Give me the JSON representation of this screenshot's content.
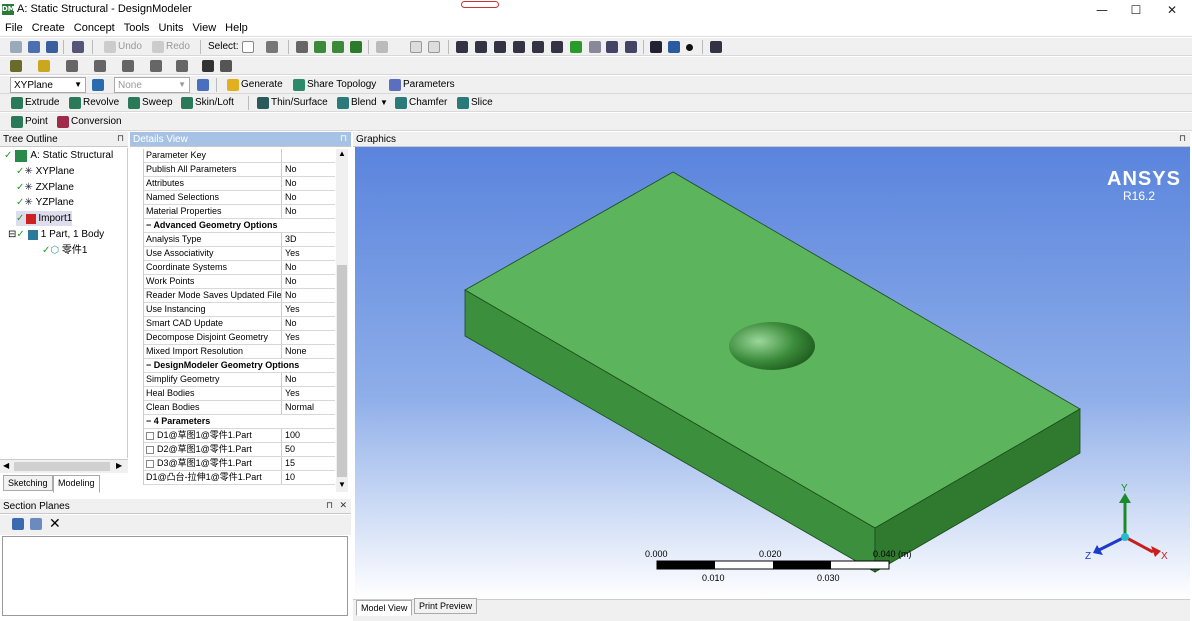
{
  "window": {
    "title": "A: Static Structural - DesignModeler",
    "logo": "DM",
    "controls": {
      "minimize": "—",
      "maximize": "☐",
      "close": "✕"
    }
  },
  "menu": [
    "File",
    "Create",
    "Concept",
    "Tools",
    "Units",
    "View",
    "Help"
  ],
  "toolbar1": {
    "undo": "Undo",
    "redo": "Redo",
    "select": "Select:"
  },
  "toolbar3": {
    "plane": "XYPlane",
    "sketch": "None",
    "generate": "Generate",
    "share_topology": "Share Topology",
    "parameters": "Parameters"
  },
  "toolbar4": [
    "Extrude",
    "Revolve",
    "Sweep",
    "Skin/Loft",
    "Thin/Surface",
    "Blend",
    "Chamfer",
    "Slice"
  ],
  "toolbar5": [
    "Point",
    "Conversion"
  ],
  "tree": {
    "title": "Tree Outline",
    "root": "A: Static Structural",
    "items": [
      "XYPlane",
      "ZXPlane",
      "YZPlane",
      "Import1",
      "1 Part, 1 Body",
      "零件1"
    ],
    "tabs": [
      "Sketching",
      "Modeling"
    ]
  },
  "details": {
    "title": "Details View",
    "rows": [
      {
        "k": "Parameter Key",
        "v": ""
      },
      {
        "k": "Publish All Parameters",
        "v": "No"
      },
      {
        "k": "Attributes",
        "v": "No"
      },
      {
        "k": "Named Selections",
        "v": "No"
      },
      {
        "k": "Material Properties",
        "v": "No"
      },
      {
        "k": "Advanced Geometry Options",
        "v": "",
        "hdr": true
      },
      {
        "k": "Analysis Type",
        "v": "3D"
      },
      {
        "k": "Use Associativity",
        "v": "Yes"
      },
      {
        "k": "Coordinate Systems",
        "v": "No"
      },
      {
        "k": "Work Points",
        "v": "No"
      },
      {
        "k": "Reader Mode Saves Updated File",
        "v": "No"
      },
      {
        "k": "Use Instancing",
        "v": "Yes"
      },
      {
        "k": "Smart CAD Update",
        "v": "No"
      },
      {
        "k": "Decompose Disjoint Geometry",
        "v": "Yes"
      },
      {
        "k": "Mixed Import Resolution",
        "v": "None"
      },
      {
        "k": "DesignModeler Geometry Options",
        "v": "",
        "hdr": true
      },
      {
        "k": "Simplify Geometry",
        "v": "No"
      },
      {
        "k": "Heal Bodies",
        "v": "Yes"
      },
      {
        "k": "Clean Bodies",
        "v": "Normal"
      },
      {
        "k": "4 Parameters",
        "v": "",
        "hdr": true
      },
      {
        "k": "D1@草图1@零件1.Part",
        "v": "100",
        "cb": true
      },
      {
        "k": "D2@草图1@零件1.Part",
        "v": "50",
        "cb": true
      },
      {
        "k": "D3@草图1@零件1.Part",
        "v": "15",
        "cb": true
      },
      {
        "k": "D1@凸台-拉伸1@零件1.Part",
        "v": "10"
      }
    ]
  },
  "section_planes": {
    "title": "Section Planes"
  },
  "graphics": {
    "title": "Graphics",
    "brand": "ANSYS",
    "version": "R16.2",
    "scale": {
      "top": [
        "0.000",
        "0.020",
        "0.040 (m)"
      ],
      "bottom": [
        "0.010",
        "0.030"
      ]
    },
    "axes": {
      "x": "X",
      "y": "Y",
      "z": "Z"
    },
    "tabs": [
      "Model View",
      "Print Preview"
    ],
    "colors": {
      "top": "#5cb55c",
      "front": "#3c8f3c",
      "side": "#2f7a2f"
    }
  }
}
